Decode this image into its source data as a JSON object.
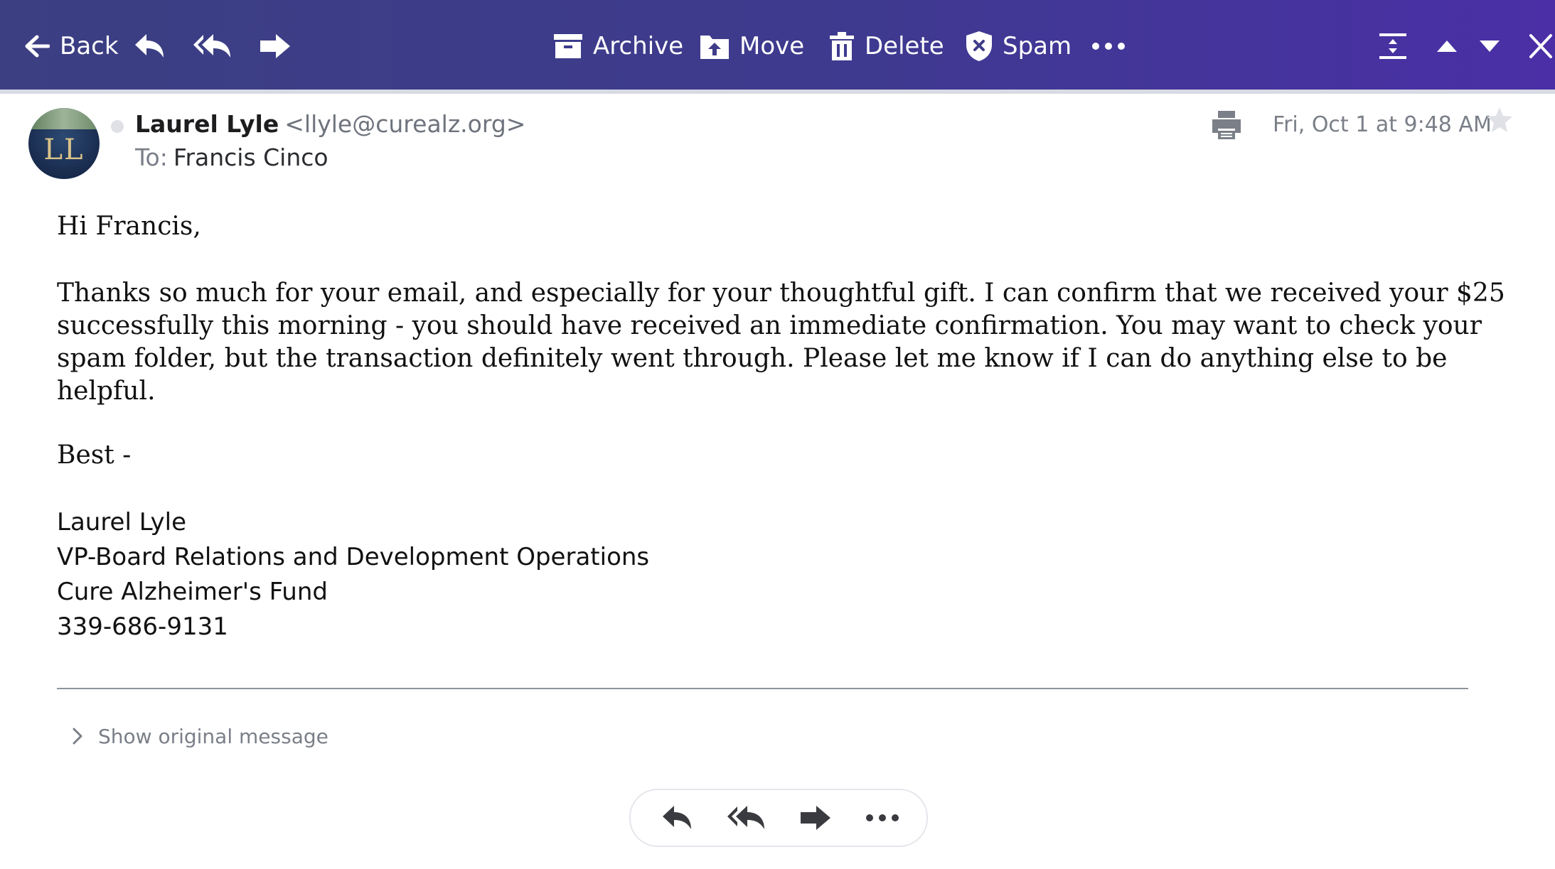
{
  "toolbar": {
    "back_label": "Back",
    "archive_label": "Archive",
    "move_label": "Move",
    "delete_label": "Delete",
    "spam_label": "Spam",
    "icons": [
      "back-arrow-icon",
      "reply-icon",
      "reply-all-icon",
      "forward-icon",
      "archive-icon",
      "move-icon",
      "delete-icon",
      "spam-shield-icon",
      "more-icon",
      "collapse-icon",
      "chevron-up-icon",
      "chevron-down-icon",
      "close-icon"
    ],
    "colors": {
      "gradient_start": "#3c3f82",
      "gradient_end": "#4a2fa6"
    }
  },
  "message": {
    "sender_name": "Laurel Lyle",
    "sender_email": "<llyle@curealz.org>",
    "to_label": "To:",
    "to_name": "Francis Cinco",
    "date": "Fri, Oct 1 at 9:48 AM",
    "avatar_initials": "LL",
    "greeting": "Hi Francis,",
    "body_lines": [
      "Thanks so much for your email, and especially for your thoughtful gift.  I can confirm that we received your $25",
      "successfully this morning - you should have received an immediate confirmation.  You may want to check your",
      "spam folder, but the transaction definitely went through.  Please let me know if I can do anything else to be",
      "helpful."
    ],
    "closing": "Best -",
    "signature": {
      "name": "Laurel Lyle",
      "title": "VP-Board Relations and Development Operations",
      "org": "Cure Alzheimer's Fund",
      "phone": "339-686-9131"
    }
  },
  "show_original_label": "Show original message"
}
